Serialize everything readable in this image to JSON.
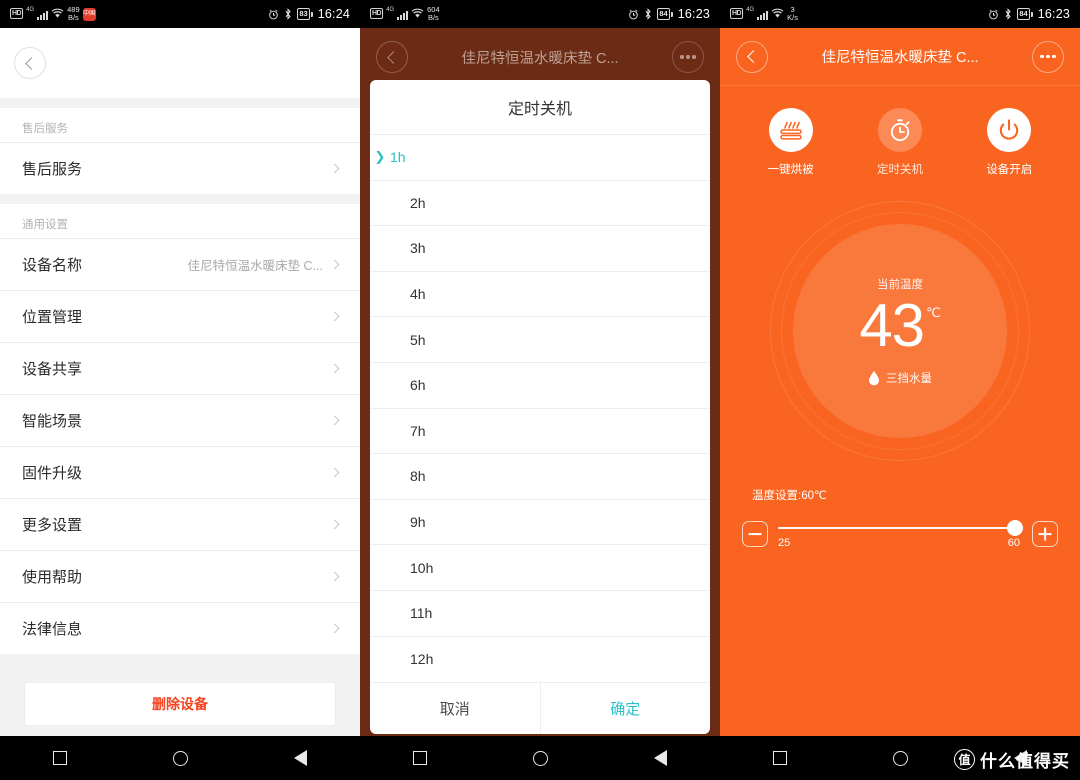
{
  "panels": {
    "left": {
      "status": {
        "network": "4G",
        "net_speed_value": "489",
        "net_speed_unit": "B/s",
        "hd": "HD",
        "battery": "83",
        "time": "16:24"
      },
      "sections": [
        {
          "title": "售后服务",
          "rows": [
            {
              "label": "售后服务",
              "value": ""
            }
          ]
        },
        {
          "title": "通用设置",
          "rows": [
            {
              "label": "设备名称",
              "value": "佳尼特恒温水暖床垫 C..."
            },
            {
              "label": "位置管理",
              "value": ""
            },
            {
              "label": "设备共享",
              "value": ""
            },
            {
              "label": "智能场景",
              "value": ""
            },
            {
              "label": "固件升级",
              "value": ""
            },
            {
              "label": "更多设置",
              "value": ""
            },
            {
              "label": "使用帮助",
              "value": ""
            },
            {
              "label": "法律信息",
              "value": ""
            }
          ]
        }
      ],
      "delete_button": "删除设备"
    },
    "middle": {
      "status": {
        "network": "4G",
        "net_speed_value": "604",
        "net_speed_unit": "B/s",
        "hd": "HD",
        "battery": "84",
        "time": "16:23"
      },
      "header_title": "佳尼特恒温水暖床垫 C...",
      "dialog": {
        "title": "定时关机",
        "selected": "1h",
        "options": [
          "1h",
          "2h",
          "3h",
          "4h",
          "5h",
          "6h",
          "7h",
          "8h",
          "9h",
          "10h",
          "11h",
          "12h"
        ],
        "cancel": "取消",
        "confirm": "确定",
        "selected_color": "#2bc0c8"
      }
    },
    "right": {
      "status": {
        "network": "4G",
        "net_speed_value": "3",
        "net_speed_unit": "K/s",
        "hd": "HD",
        "battery": "84",
        "time": "16:23"
      },
      "header_title": "佳尼特恒温水暖床垫 C...",
      "accent": "#f96420",
      "actions": [
        {
          "label": "一键烘被",
          "icon": "heat-waves-icon",
          "active": true
        },
        {
          "label": "定时关机",
          "icon": "stopwatch-icon",
          "active": false
        },
        {
          "label": "设备开启",
          "icon": "power-icon",
          "active": true
        }
      ],
      "dial": {
        "caption": "当前温度",
        "value": "43",
        "unit": "℃",
        "water_level": "三挡水量",
        "water_icon": "water-drop-icon"
      },
      "slider": {
        "label": "温度设置:60℃",
        "min": "25",
        "max": "60",
        "value": 60,
        "minus": "minus-icon",
        "plus": "plus-icon"
      }
    }
  },
  "watermark": {
    "logo": "值",
    "text": "什么值得买"
  }
}
